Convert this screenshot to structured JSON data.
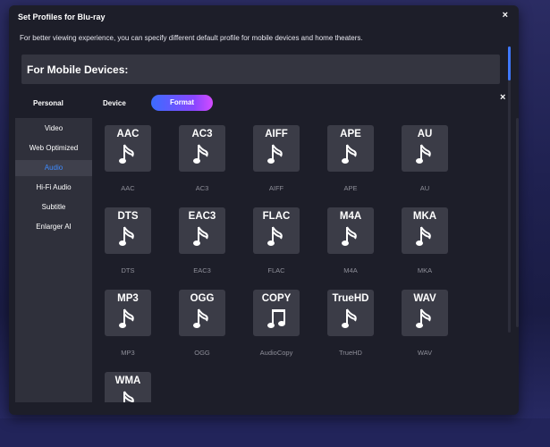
{
  "dialog": {
    "title": "Set Profiles for Blu-ray",
    "close_icon": "×",
    "description": "For better viewing experience, you can specify different default profile for mobile devices and home theaters.",
    "section_title": "For Mobile Devices:"
  },
  "panel": {
    "close_icon": "×",
    "tabs": [
      "Personal",
      "Device",
      "Format"
    ],
    "active_tab": "Format",
    "sidebar_items": [
      "Video",
      "Web Optimized",
      "Audio",
      "Hi-Fi Audio",
      "Subtitle",
      "Enlarger AI"
    ],
    "active_sidebar_item": "Audio"
  },
  "formats": [
    {
      "tile": "AAC",
      "caption": "AAC"
    },
    {
      "tile": "AC3",
      "caption": "AC3"
    },
    {
      "tile": "AIFF",
      "caption": "AIFF"
    },
    {
      "tile": "APE",
      "caption": "APE"
    },
    {
      "tile": "AU",
      "caption": "AU"
    },
    {
      "tile": "DTS",
      "caption": "DTS"
    },
    {
      "tile": "EAC3",
      "caption": "EAC3"
    },
    {
      "tile": "FLAC",
      "caption": "FLAC"
    },
    {
      "tile": "M4A",
      "caption": "M4A"
    },
    {
      "tile": "MKA",
      "caption": "MKA"
    },
    {
      "tile": "MP3",
      "caption": "MP3"
    },
    {
      "tile": "OGG",
      "caption": "OGG"
    },
    {
      "tile": "COPY",
      "caption": "AudioCopy"
    },
    {
      "tile": "TrueHD",
      "caption": "TrueHD"
    },
    {
      "tile": "WAV",
      "caption": "WAV"
    },
    {
      "tile": "WMA",
      "caption": ""
    }
  ],
  "icons": {
    "note": "music-note-icon",
    "copy": "double-music-note-icon"
  },
  "colors": {
    "accent": "#3f8bff",
    "format_tab_gradient": [
      "#3b6cff",
      "#8a46ff",
      "#d44bff"
    ],
    "dialog_bg": "#1d1e29",
    "tile_bg": "#3b3c47"
  }
}
